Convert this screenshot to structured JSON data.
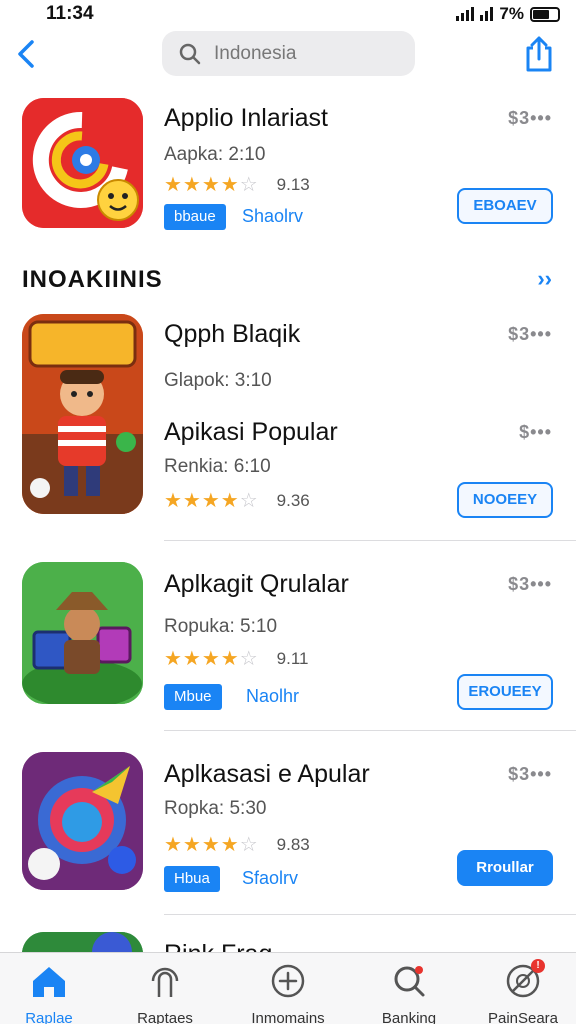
{
  "status": {
    "time": "11:34",
    "battery": "7%"
  },
  "search": {
    "placeholder": "Indonesia"
  },
  "featured": {
    "name": "Applio Inlariast",
    "sub": "Aapka: 2:10",
    "stars": "★★★★",
    "stars_empty": "☆",
    "rating": "9.13",
    "tag": "bbaue",
    "tag2": "Shaolrv",
    "price": "$3•••",
    "button": "EBOAEV"
  },
  "section": {
    "title": "INOAKIINIS",
    "more": "››"
  },
  "apps": [
    {
      "name": "Qpph Blaqik",
      "sub": "Glapok: 3:10",
      "price": "$3•••"
    },
    {
      "name": "Apikasi Popular",
      "sub": "Renkia: 6:10",
      "stars": "★★★★",
      "stars_empty": "☆",
      "rating": "9.36",
      "price": "$•••",
      "button": "NOOEEY"
    },
    {
      "name": "Aplkagit Qrulalar",
      "sub": "Ropuka: 5:10",
      "stars": "★★★★",
      "stars_empty": "☆",
      "rating": "9.11",
      "tag": "Mbue",
      "tag2": "Naolhr",
      "price": "$3•••",
      "button": "EROUEEY"
    },
    {
      "name": "Aplkasasi e Apular",
      "sub": "Ropka: 5:30",
      "stars": "★★★★",
      "stars_empty": "☆",
      "rating": "9.83",
      "tag": "Hbua",
      "tag2": "Sfaolrv",
      "price": "$3•••",
      "button": "Rroullar"
    },
    {
      "name": "Rink Fraq..."
    }
  ],
  "tabs": [
    {
      "label": "Raplae",
      "icon": "home-icon",
      "active": true
    },
    {
      "label": "Raptaes",
      "icon": "apps-icon"
    },
    {
      "label": "Inmomains",
      "icon": "plus-circle-icon"
    },
    {
      "label": "Banking",
      "icon": "search-icon"
    },
    {
      "label": "PainSeara",
      "icon": "profile-icon",
      "badge": "!"
    }
  ],
  "colors": {
    "accent": "#1a84f4",
    "star": "#f5a623",
    "badge": "#e8342e"
  }
}
